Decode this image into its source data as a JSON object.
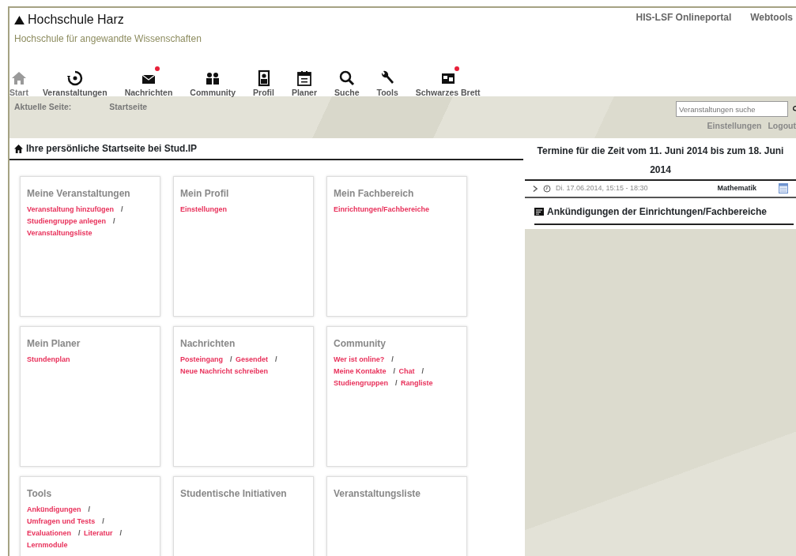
{
  "header": {
    "title": "Hochschule Harz",
    "subtitle": "Hochschule für angewandte Wissenschaften",
    "top_links": [
      "HIS-LSF Onlineportal",
      "Webtools"
    ]
  },
  "nav": [
    {
      "label": "Start",
      "selected": true,
      "notification": false
    },
    {
      "label": "Veranstaltungen",
      "selected": false,
      "notification": false
    },
    {
      "label": "Nachrichten",
      "selected": false,
      "notification": true
    },
    {
      "label": "Community",
      "selected": false,
      "notification": false
    },
    {
      "label": "Profil",
      "selected": false,
      "notification": false
    },
    {
      "label": "Planer",
      "selected": false,
      "notification": false
    },
    {
      "label": "Suche",
      "selected": false,
      "notification": false
    },
    {
      "label": "Tools",
      "selected": false,
      "notification": false
    },
    {
      "label": "Schwarzes Brett",
      "selected": false,
      "notification": true
    }
  ],
  "breadcrumb": {
    "label": "Aktuelle Seite:",
    "page": "Startseite"
  },
  "search": {
    "placeholder": "Veranstaltungen suche"
  },
  "user_links": [
    "Einstellungen",
    "Logout"
  ],
  "page_heading": "Ihre persönliche Startseite bei Stud.IP",
  "widgets": [
    {
      "title": "Meine Veranstaltungen",
      "links": [
        {
          "label": "Veranstaltung hinzufügen",
          "separator": "/"
        },
        {
          "label": "Studiengruppe anlegen",
          "separator": "/"
        },
        {
          "label": "Veranstaltungsliste"
        }
      ]
    },
    {
      "title": "Mein Profil",
      "links": [
        {
          "label": "Einstellungen"
        }
      ]
    },
    {
      "title": "Mein Fachbereich",
      "links": [
        {
          "label": "Einrichtungen/Fachbereiche"
        }
      ]
    },
    {
      "title": "Mein Planer",
      "links": [
        {
          "label": "Stundenplan"
        }
      ]
    },
    {
      "title": "Nachrichten",
      "links": [
        {
          "label": "Posteingang",
          "separator": "/"
        },
        {
          "label": "Gesendet",
          "separator": "/"
        },
        {
          "label": "Neue Nachricht schreiben"
        }
      ]
    },
    {
      "title": "Community",
      "links": [
        {
          "label": "Wer ist online?",
          "separator": "/"
        },
        {
          "label": "Meine Kontakte",
          "separator": "/"
        },
        {
          "label": "Chat",
          "separator": "/"
        },
        {
          "label": "Studiengruppen",
          "separator": "/"
        },
        {
          "label": "Rangliste"
        }
      ]
    },
    {
      "title": "Tools",
      "links": [
        {
          "label": "Ankündigungen",
          "separator": "/"
        },
        {
          "label": "Umfragen und Tests",
          "separator": "/"
        },
        {
          "label": "Evaluationen",
          "separator": "/"
        },
        {
          "label": "Literatur",
          "separator": "/"
        },
        {
          "label": "Lernmodule"
        }
      ]
    },
    {
      "title": "Studentische Initiativen"
    },
    {
      "title": "Veranstaltungsliste"
    }
  ],
  "schedule": {
    "title": "Termine für die Zeit vom 11. Juni 2014 bis zum 18. Juni 2014",
    "events": [
      {
        "time": "Di. 17.06.2014, 15:15 - 18:30",
        "course": "Mathematik"
      }
    ]
  },
  "announcements": {
    "title": "Ankündigungen der Einrichtungen/Fachbereiche"
  }
}
